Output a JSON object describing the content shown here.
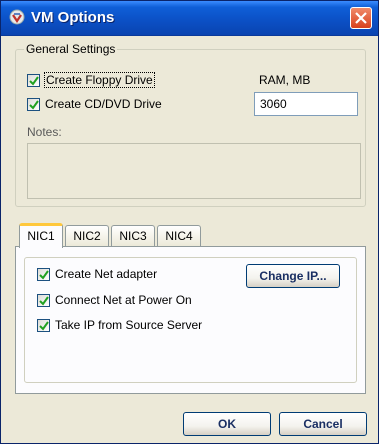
{
  "window": {
    "title": "VM Options"
  },
  "general": {
    "legend": "General Settings",
    "floppy_label": "Create Floppy Drive",
    "floppy_checked": true,
    "cd_label": "Create CD/DVD Drive",
    "cd_checked": true,
    "ram_label": "RAM, MB",
    "ram_value": "3060",
    "notes_label": "Notes:",
    "notes_value": ""
  },
  "tabs": [
    {
      "label": "NIC1",
      "active": true
    },
    {
      "label": "NIC2",
      "active": false
    },
    {
      "label": "NIC3",
      "active": false
    },
    {
      "label": "NIC4",
      "active": false
    }
  ],
  "nic": {
    "create_adapter_label": "Create Net adapter",
    "create_adapter_checked": true,
    "connect_label": "Connect Net at Power On",
    "connect_checked": true,
    "take_ip_label": "Take IP from Source Server",
    "take_ip_checked": true,
    "change_ip_label": "Change IP..."
  },
  "footer": {
    "ok_label": "OK",
    "cancel_label": "Cancel"
  }
}
